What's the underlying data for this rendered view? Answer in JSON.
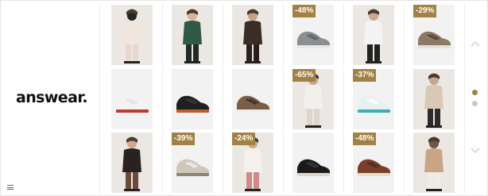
{
  "brand": {
    "logo_text": "answear.",
    "menu_icon": "menu-icon"
  },
  "colors": {
    "badge_bg": "#a38143",
    "active_dot": "#a38143",
    "inactive_dot": "#c8c8c8"
  },
  "products": [
    {
      "kind": "model",
      "desc": "woman in white tulle dress",
      "badge": ""
    },
    {
      "kind": "model",
      "desc": "man in green half-zip sweatshirt",
      "badge": ""
    },
    {
      "kind": "model",
      "desc": "woman in brown fur coat",
      "badge": ""
    },
    {
      "kind": "shoe",
      "desc": "grey sneaker",
      "badge": "-48%"
    },
    {
      "kind": "model",
      "desc": "woman in white graphic sweatshirt",
      "badge": ""
    },
    {
      "kind": "shoe",
      "desc": "brown suede sneaker",
      "badge": "-29%"
    },
    {
      "kind": "shoe",
      "desc": "white sneakers red heel",
      "badge": ""
    },
    {
      "kind": "shoe",
      "desc": "black hiking boot",
      "badge": ""
    },
    {
      "kind": "shoe",
      "desc": "brown three stripe sneaker",
      "badge": ""
    },
    {
      "kind": "model",
      "desc": "woman in white knit sweater",
      "badge": "-65%"
    },
    {
      "kind": "shoe",
      "desc": "white teal running shoe",
      "badge": "-37%"
    },
    {
      "kind": "model",
      "desc": "woman in beige sweater",
      "badge": ""
    },
    {
      "kind": "model",
      "desc": "woman in black shearling jacket",
      "badge": ""
    },
    {
      "kind": "shoe",
      "desc": "beige high-top sneaker",
      "badge": "-39%"
    },
    {
      "kind": "model",
      "desc": "woman in printed white shirt",
      "badge": "-24%"
    },
    {
      "kind": "shoe",
      "desc": "black leather sneaker",
      "badge": ""
    },
    {
      "kind": "shoe",
      "desc": "brown leather sneaker",
      "badge": "-48%"
    },
    {
      "kind": "model",
      "desc": "woman in check shirt",
      "badge": ""
    }
  ],
  "carousel": {
    "pages": 2,
    "current": 1
  }
}
